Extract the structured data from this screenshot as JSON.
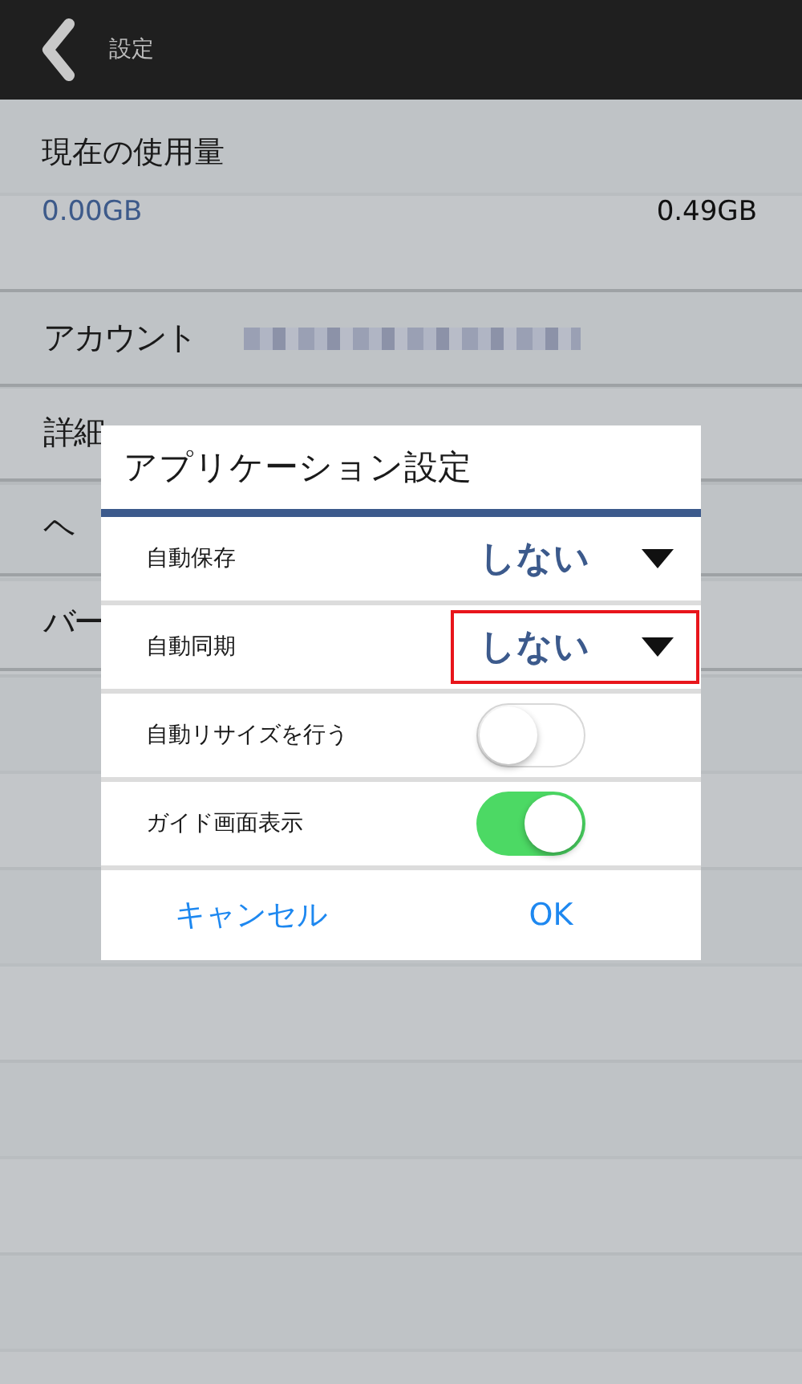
{
  "header": {
    "title": "設定"
  },
  "usage": {
    "label": "現在の使用量",
    "used": "0.00GB",
    "total": "0.49GB"
  },
  "rows": [
    {
      "label": "アカウント",
      "redacted": true
    },
    {
      "label": "詳細",
      "redacted": false
    },
    {
      "label": "ヘ",
      "redacted": false
    },
    {
      "label": "バー",
      "redacted": false
    }
  ],
  "dialog": {
    "title": "アプリケーション設定",
    "settings": [
      {
        "kind": "dropdown",
        "label": "自動保存",
        "value": "しない",
        "highlighted": false
      },
      {
        "kind": "dropdown",
        "label": "自動同期",
        "value": "しない",
        "highlighted": true
      },
      {
        "kind": "toggle",
        "label": "自動リサイズを行う",
        "on": false
      },
      {
        "kind": "toggle",
        "label": "ガイド画面表示",
        "on": true
      }
    ],
    "buttons": [
      "キャンセル",
      "OK"
    ]
  }
}
